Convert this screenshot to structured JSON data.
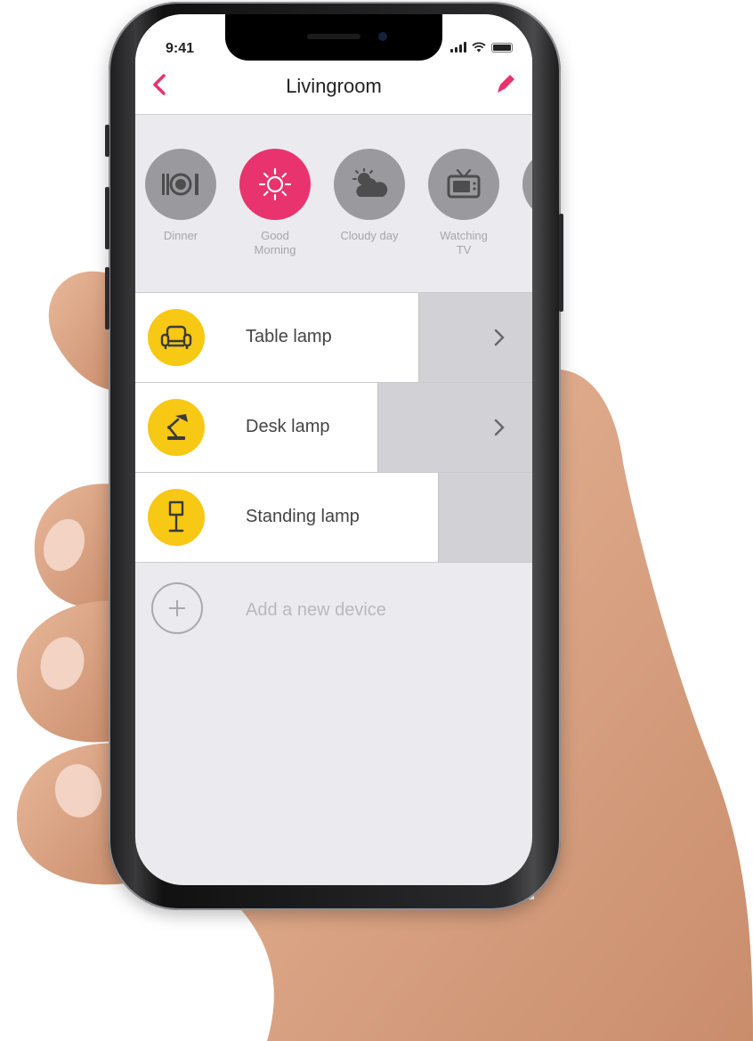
{
  "status_bar": {
    "time": "9:41"
  },
  "header": {
    "title": "Livingroom"
  },
  "scenes": [
    {
      "label": "Dinner",
      "icon": "dinner-plate-icon",
      "active": false
    },
    {
      "label": "Good Morning",
      "icon": "sun-icon",
      "active": true
    },
    {
      "label": "Cloudy day",
      "icon": "cloudy-sun-icon",
      "active": false
    },
    {
      "label": "Watching TV",
      "icon": "tv-icon",
      "active": false
    }
  ],
  "devices": [
    {
      "name": "Table lamp",
      "icon": "armchair-icon"
    },
    {
      "name": "Desk lamp",
      "icon": "desk-lamp-icon"
    },
    {
      "name": "Standing lamp",
      "icon": "floor-lamp-icon"
    }
  ],
  "add_device": {
    "label": "Add a new device",
    "icon": "plus-icon"
  },
  "colors": {
    "accent": "#e8336e",
    "device_icon_bg": "#f7c814",
    "scene_inactive": "#9a9a9e"
  }
}
